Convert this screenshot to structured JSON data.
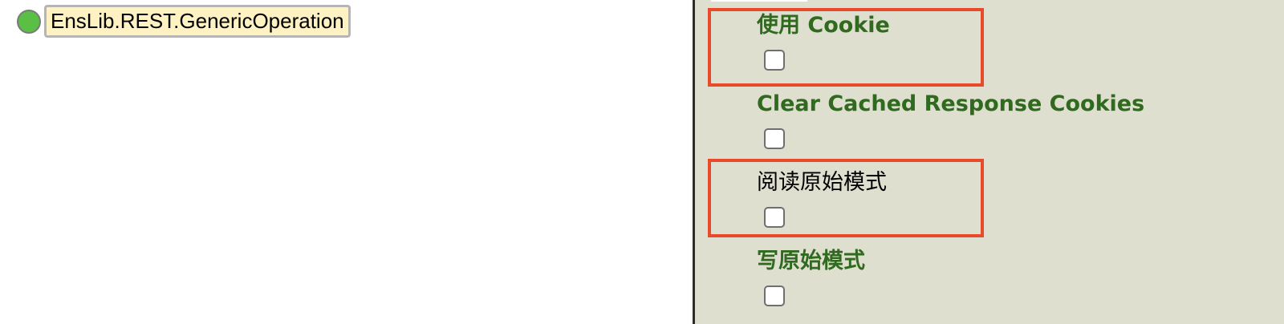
{
  "diagram": {
    "host": {
      "name": "EnsLib.REST.GenericOperation",
      "status_color": "#5bbf45"
    }
  },
  "settings": {
    "items": [
      {
        "label": "使用 Cookie",
        "checked": false,
        "highlighted": true,
        "emphasis": true
      },
      {
        "label": "Clear Cached Response Cookies",
        "checked": false,
        "highlighted": false,
        "emphasis": true
      },
      {
        "label": "阅读原始模式",
        "checked": false,
        "highlighted": true,
        "emphasis": false
      },
      {
        "label": "写原始模式",
        "checked": false,
        "highlighted": false,
        "emphasis": true
      }
    ]
  },
  "colors": {
    "label_green": "#2f6a1e",
    "highlight_red": "#e84a2c",
    "panel_bg": "#dfdfd0",
    "host_label_bg": "#fff2c2"
  }
}
